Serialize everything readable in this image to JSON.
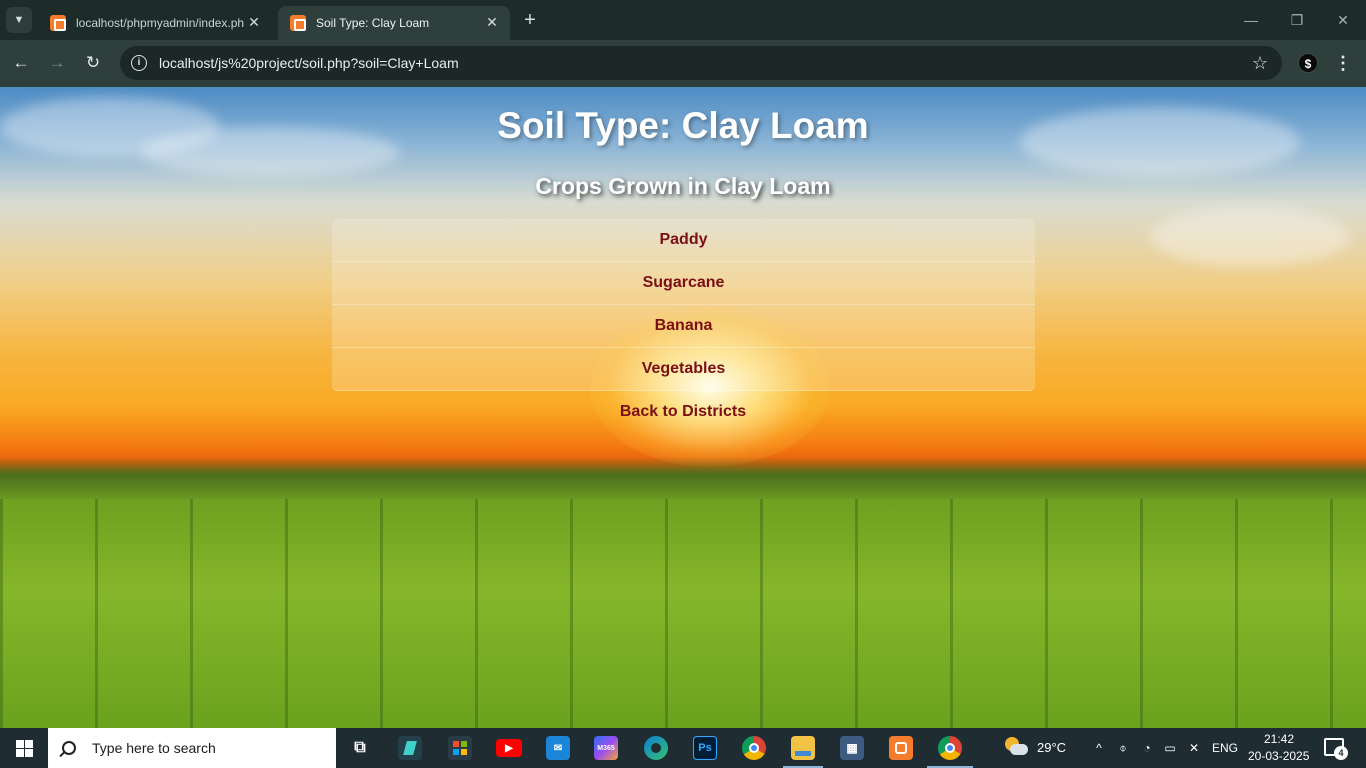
{
  "browser": {
    "tabs": [
      {
        "title": "localhost/phpmyadmin/index.php",
        "active": false
      },
      {
        "title": "Soil Type: Clay Loam",
        "active": true
      }
    ],
    "url": "localhost/js%20project/soil.php?soil=Clay+Loam",
    "extension_label": "$"
  },
  "page": {
    "title": "Soil Type: Clay Loam",
    "subtitle": "Crops Grown in Clay Loam",
    "crops": [
      "Paddy",
      "Sugarcane",
      "Banana",
      "Vegetables"
    ],
    "back_link": "Back to Districts"
  },
  "taskbar": {
    "search_placeholder": "Type here to search",
    "pinned": [
      "task-view",
      "app-2",
      "store",
      "youtube",
      "mail",
      "m365",
      "edge",
      "photoshop",
      "chrome",
      "file-explorer",
      "app-11",
      "xampp",
      "chrome-profile"
    ],
    "m365_label": "M365",
    "photoshop_label": "Ps",
    "temperature": "29°C",
    "language": "ENG",
    "time": "21:42",
    "date": "20-03-2025",
    "notification_count": "4"
  }
}
